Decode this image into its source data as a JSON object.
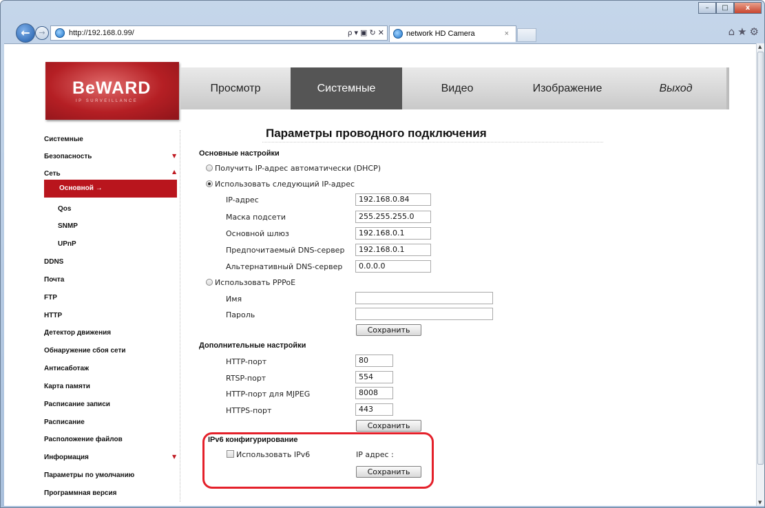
{
  "browser": {
    "url": "http://192.168.0.99/",
    "tab_title": "network HD Camera",
    "tab_close": "×",
    "addr_tools": "ρ ▾ ▣ ↻ ✕",
    "right_tools": "⌂★⚙",
    "window_buttons": {
      "minimize": "–",
      "maximize": "□",
      "close": "x"
    }
  },
  "logo": {
    "text": "BeWARD",
    "sub": "IP SURVEILLANCE"
  },
  "menu": {
    "items": [
      {
        "label": "Просмотр"
      },
      {
        "label": "Системные",
        "active": true
      },
      {
        "label": "Видео"
      },
      {
        "label": "Изображение"
      },
      {
        "label": "Выход"
      }
    ]
  },
  "sidebar": {
    "items": [
      {
        "label": "Системные"
      },
      {
        "label": "Безопасность",
        "expand": "▼"
      },
      {
        "label": "Сеть",
        "expand": "▲"
      },
      {
        "label": "Основной →",
        "selected": true
      },
      {
        "label": "Qos"
      },
      {
        "label": "SNMP"
      },
      {
        "label": "UPnP"
      },
      {
        "label": "DDNS"
      },
      {
        "label": "Почта"
      },
      {
        "label": "FTP"
      },
      {
        "label": "HTTP"
      },
      {
        "label": "Детектор движения"
      },
      {
        "label": "Обнаружение сбоя сети"
      },
      {
        "label": "Антисаботаж"
      },
      {
        "label": "Карта памяти"
      },
      {
        "label": "Расписание записи"
      },
      {
        "label": "Расписание"
      },
      {
        "label": "Расположение файлов"
      },
      {
        "label": "Информация",
        "expand": "▼"
      },
      {
        "label": "Параметры по умолчанию"
      },
      {
        "label": "Программная версия"
      }
    ]
  },
  "page": {
    "title": "Параметры проводного подключения",
    "basic": {
      "heading": "Основные настройки",
      "dhcp_label": "Получить IP-адрес автоматически (DHCP)",
      "static_label": "Использовать следующий IP-адрес",
      "selected": "static",
      "ip_label": "IP-адрес",
      "ip_value": "192.168.0.84",
      "mask_label": "Маска подсети",
      "mask_value": "255.255.255.0",
      "gateway_label": "Основной шлюз",
      "gateway_value": "192.168.0.1",
      "dns1_label": "Предпочитаемый DNS-сервер",
      "dns1_value": "192.168.0.1",
      "dns2_label": "Альтернативный DNS-сервер",
      "dns2_value": "0.0.0.0",
      "pppoe_label": "Использовать PPPoE",
      "name_label": "Имя",
      "name_value": "",
      "password_label": "Пароль",
      "password_value": "",
      "save": "Сохранить"
    },
    "advanced": {
      "heading": "Дополнительные настройки",
      "http_label": "HTTP-порт",
      "http_value": "80",
      "rtsp_label": "RTSP-порт",
      "rtsp_value": "554",
      "mjpeg_label": "HTTP-порт для MJPEG",
      "mjpeg_value": "8008",
      "https_label": "HTTPS-порт",
      "https_value": "443",
      "save": "Сохранить"
    },
    "ipv6": {
      "heading": "IPv6 конфигурирование",
      "use_label": "Использовать IPv6",
      "checked": false,
      "ip_label": "IP адрес :",
      "save": "Сохранить",
      "highlight_color": "#e4202a"
    }
  },
  "colors": {
    "accent": "#b9151d",
    "menu_active": "#555555"
  }
}
